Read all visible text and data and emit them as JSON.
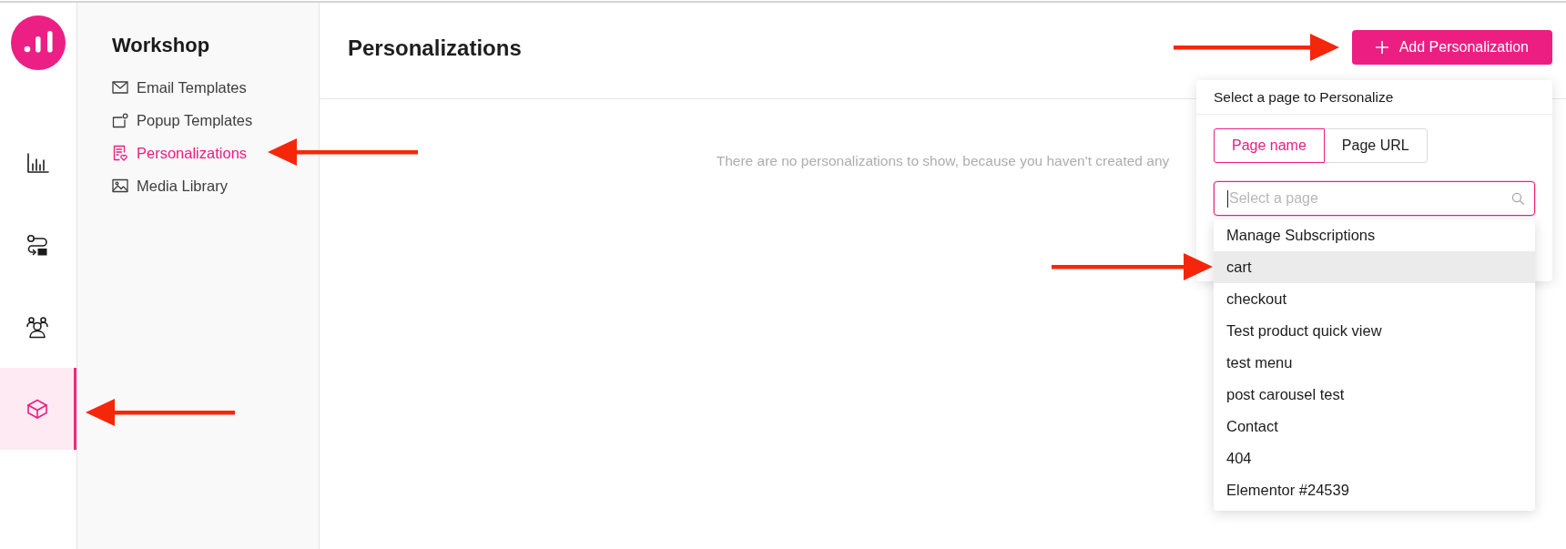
{
  "rail": {
    "items": [
      {
        "selected": false
      },
      {
        "selected": false
      },
      {
        "selected": false
      },
      {
        "selected": true
      }
    ]
  },
  "sidebar": {
    "title": "Workshop",
    "items": [
      {
        "label": "Email Templates",
        "selected": false
      },
      {
        "label": "Popup Templates",
        "selected": false
      },
      {
        "label": "Personalizations",
        "selected": true
      },
      {
        "label": "Media Library",
        "selected": false
      }
    ]
  },
  "header": {
    "title": "Personalizations",
    "add_button": {
      "label": "Add Personalization"
    }
  },
  "empty_message": "There are no personalizations to show, because you haven't created any",
  "page_picker": {
    "title": "Select a page to Personalize",
    "modes": [
      {
        "label": "Page name",
        "selected": true
      },
      {
        "label": "Page URL",
        "selected": false
      }
    ],
    "search": {
      "placeholder": "Select a page",
      "focused": true
    },
    "options": [
      {
        "label": "Manage Subscriptions",
        "highlighted": false
      },
      {
        "label": "cart",
        "highlighted": true
      },
      {
        "label": "checkout",
        "highlighted": false
      },
      {
        "label": "Test product quick view",
        "highlighted": false
      },
      {
        "label": "test menu",
        "highlighted": false
      },
      {
        "label": "post carousel test",
        "highlighted": false
      },
      {
        "label": "Contact",
        "highlighted": false
      },
      {
        "label": "404",
        "highlighted": false
      },
      {
        "label": "Elementor #24539",
        "highlighted": false
      }
    ]
  },
  "annotation_arrows": [
    {
      "kind": "rightward"
    },
    {
      "kind": "leftward"
    },
    {
      "kind": "rightward"
    },
    {
      "kind": "leftward"
    }
  ]
}
